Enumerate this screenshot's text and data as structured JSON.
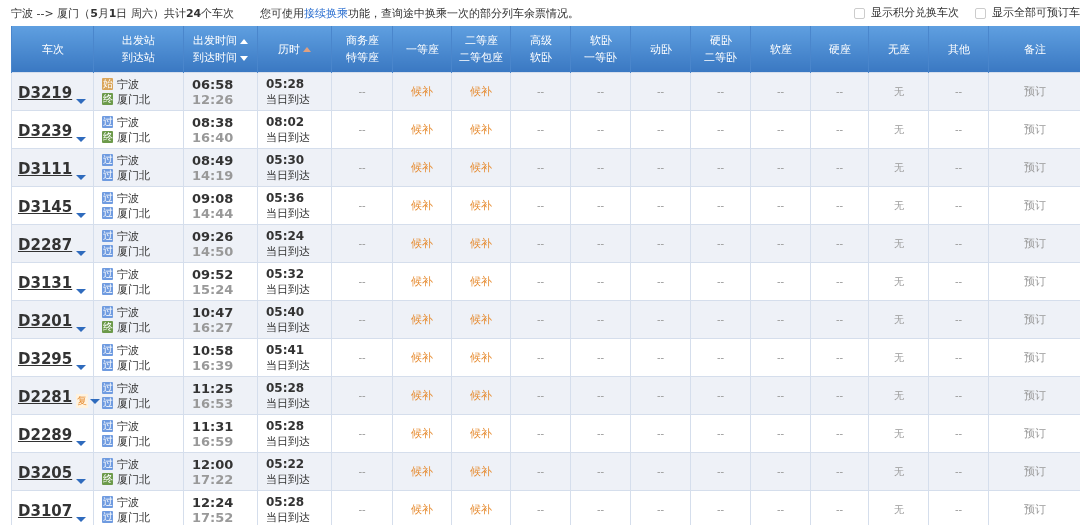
{
  "summary": "宁波 --> 厦门（**5**月**1**日  周六）共计**24**个车次",
  "notice": {
    "before": "您可使用",
    "link": "接续换乘",
    "after": "功能，查询途中换乘一次的部分列车余票情况。"
  },
  "filters": [
    {
      "label": "显示积分兑换车次",
      "checked": false
    },
    {
      "label": "显示全部可预订车",
      "checked": false
    }
  ],
  "table": {
    "columns": [
      {
        "lines": [
          {
            "text": "车次"
          }
        ]
      },
      {
        "lines": [
          {
            "text": "出发站"
          },
          {
            "text": "到达站"
          }
        ]
      },
      {
        "lines": [
          {
            "text": "出发时间",
            "arrow_up": true
          },
          {
            "text": "到达时间",
            "arrow_down": true
          }
        ]
      },
      {
        "lines": [
          {
            "text": "历时",
            "arrow_up": true,
            "dimmed": true
          }
        ]
      },
      {
        "lines": [
          {
            "text": "商务座"
          },
          {
            "text": "特等座"
          }
        ]
      },
      {
        "lines": [
          {
            "text": "一等座"
          }
        ]
      },
      {
        "lines": [
          {
            "text": "二等座"
          },
          {
            "text": "二等包座"
          }
        ]
      },
      {
        "lines": [
          {
            "text": "高级"
          },
          {
            "text": "软卧"
          }
        ]
      },
      {
        "lines": [
          {
            "text": "软卧"
          },
          {
            "text": "一等卧"
          }
        ]
      },
      {
        "lines": [
          {
            "text": "动卧"
          }
        ]
      },
      {
        "lines": [
          {
            "text": "硬卧"
          },
          {
            "text": "二等卧"
          }
        ]
      },
      {
        "lines": [
          {
            "text": "软座"
          }
        ]
      },
      {
        "lines": [
          {
            "text": "硬座"
          }
        ]
      },
      {
        "lines": [
          {
            "text": "无座"
          }
        ]
      },
      {
        "lines": [
          {
            "text": "其他"
          }
        ]
      },
      {
        "lines": [
          {
            "text": "备注"
          }
        ]
      }
    ],
    "rows": [
      {
        "train": "D3219",
        "from": {
          "badge": "始",
          "kind": "start",
          "name": "宁波"
        },
        "to": {
          "badge": "终",
          "kind": "end",
          "name": "厦门北"
        },
        "depart": "06:58",
        "arrive": "12:26",
        "duration": "05:28",
        "arrival_day": "当日到达",
        "seats": [
          "--",
          "候补",
          "候补",
          "--",
          "--",
          "--",
          "--",
          "--",
          "--",
          "无",
          "--"
        ],
        "action": {
          "label": "预订",
          "disabled": true
        }
      },
      {
        "train": "D3239",
        "from": {
          "badge": "过",
          "kind": "pass",
          "name": "宁波"
        },
        "to": {
          "badge": "终",
          "kind": "end",
          "name": "厦门北"
        },
        "depart": "08:38",
        "arrive": "16:40",
        "duration": "08:02",
        "arrival_day": "当日到达",
        "seats": [
          "--",
          "候补",
          "候补",
          "--",
          "--",
          "--",
          "--",
          "--",
          "--",
          "无",
          "--"
        ],
        "action": {
          "label": "预订",
          "disabled": true
        }
      },
      {
        "train": "D3111",
        "from": {
          "badge": "过",
          "kind": "pass",
          "name": "宁波"
        },
        "to": {
          "badge": "过",
          "kind": "pass",
          "name": "厦门北"
        },
        "depart": "08:49",
        "arrive": "14:19",
        "duration": "05:30",
        "arrival_day": "当日到达",
        "seats": [
          "--",
          "候补",
          "候补",
          "--",
          "--",
          "--",
          "--",
          "--",
          "--",
          "无",
          "--"
        ],
        "action": {
          "label": "预订",
          "disabled": true
        }
      },
      {
        "train": "D3145",
        "from": {
          "badge": "过",
          "kind": "pass",
          "name": "宁波"
        },
        "to": {
          "badge": "过",
          "kind": "pass",
          "name": "厦门北"
        },
        "depart": "09:08",
        "arrive": "14:44",
        "duration": "05:36",
        "arrival_day": "当日到达",
        "seats": [
          "--",
          "候补",
          "候补",
          "--",
          "--",
          "--",
          "--",
          "--",
          "--",
          "无",
          "--"
        ],
        "action": {
          "label": "预订",
          "disabled": true
        }
      },
      {
        "train": "D2287",
        "from": {
          "badge": "过",
          "kind": "pass",
          "name": "宁波"
        },
        "to": {
          "badge": "过",
          "kind": "pass",
          "name": "厦门北"
        },
        "depart": "09:26",
        "arrive": "14:50",
        "duration": "05:24",
        "arrival_day": "当日到达",
        "seats": [
          "--",
          "候补",
          "候补",
          "--",
          "--",
          "--",
          "--",
          "--",
          "--",
          "无",
          "--"
        ],
        "action": {
          "label": "预订",
          "disabled": true
        }
      },
      {
        "train": "D3131",
        "from": {
          "badge": "过",
          "kind": "pass",
          "name": "宁波"
        },
        "to": {
          "badge": "过",
          "kind": "pass",
          "name": "厦门北"
        },
        "depart": "09:52",
        "arrive": "15:24",
        "duration": "05:32",
        "arrival_day": "当日到达",
        "seats": [
          "--",
          "候补",
          "候补",
          "--",
          "--",
          "--",
          "--",
          "--",
          "--",
          "无",
          "--"
        ],
        "action": {
          "label": "预订",
          "disabled": true
        }
      },
      {
        "train": "D3201",
        "from": {
          "badge": "过",
          "kind": "pass",
          "name": "宁波"
        },
        "to": {
          "badge": "终",
          "kind": "end",
          "name": "厦门北"
        },
        "depart": "10:47",
        "arrive": "16:27",
        "duration": "05:40",
        "arrival_day": "当日到达",
        "seats": [
          "--",
          "候补",
          "候补",
          "--",
          "--",
          "--",
          "--",
          "--",
          "--",
          "无",
          "--"
        ],
        "action": {
          "label": "预订",
          "disabled": true
        }
      },
      {
        "train": "D3295",
        "from": {
          "badge": "过",
          "kind": "pass",
          "name": "宁波"
        },
        "to": {
          "badge": "过",
          "kind": "pass",
          "name": "厦门北"
        },
        "depart": "10:58",
        "arrive": "16:39",
        "duration": "05:41",
        "arrival_day": "当日到达",
        "seats": [
          "--",
          "候补",
          "候补",
          "--",
          "--",
          "--",
          "--",
          "--",
          "--",
          "无",
          "--"
        ],
        "action": {
          "label": "预订",
          "disabled": true
        }
      },
      {
        "train": "D2281",
        "resume": "复",
        "from": {
          "badge": "过",
          "kind": "pass",
          "name": "宁波"
        },
        "to": {
          "badge": "过",
          "kind": "pass",
          "name": "厦门北"
        },
        "depart": "11:25",
        "arrive": "16:53",
        "duration": "05:28",
        "arrival_day": "当日到达",
        "seats": [
          "--",
          "候补",
          "候补",
          "--",
          "--",
          "--",
          "--",
          "--",
          "--",
          "无",
          "--"
        ],
        "action": {
          "label": "预订",
          "disabled": true
        }
      },
      {
        "train": "D2289",
        "from": {
          "badge": "过",
          "kind": "pass",
          "name": "宁波"
        },
        "to": {
          "badge": "过",
          "kind": "pass",
          "name": "厦门北"
        },
        "depart": "11:31",
        "arrive": "16:59",
        "duration": "05:28",
        "arrival_day": "当日到达",
        "seats": [
          "--",
          "候补",
          "候补",
          "--",
          "--",
          "--",
          "--",
          "--",
          "--",
          "无",
          "--"
        ],
        "action": {
          "label": "预订",
          "disabled": true
        }
      },
      {
        "train": "D3205",
        "from": {
          "badge": "过",
          "kind": "pass",
          "name": "宁波"
        },
        "to": {
          "badge": "终",
          "kind": "end",
          "name": "厦门北"
        },
        "depart": "12:00",
        "arrive": "17:22",
        "duration": "05:22",
        "arrival_day": "当日到达",
        "seats": [
          "--",
          "候补",
          "候补",
          "--",
          "--",
          "--",
          "--",
          "--",
          "--",
          "无",
          "--"
        ],
        "action": {
          "label": "预订",
          "disabled": true
        }
      },
      {
        "train": "D3107",
        "from": {
          "badge": "过",
          "kind": "pass",
          "name": "宁波"
        },
        "to": {
          "badge": "过",
          "kind": "pass",
          "name": "厦门北"
        },
        "depart": "12:24",
        "arrive": "17:52",
        "duration": "05:28",
        "arrival_day": "当日到达",
        "seats": [
          "--",
          "候补",
          "候补",
          "--",
          "--",
          "--",
          "--",
          "--",
          "--",
          "无",
          "--"
        ],
        "action": {
          "label": "预订",
          "disabled": true
        }
      }
    ]
  }
}
